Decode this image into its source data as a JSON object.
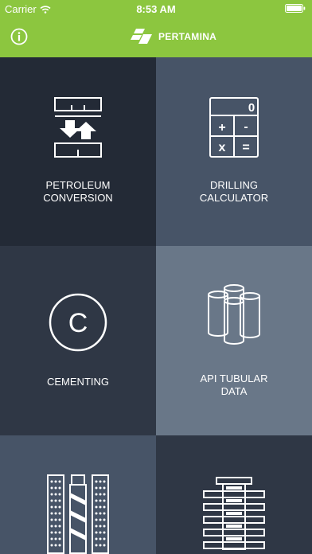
{
  "status_bar": {
    "carrier": "Carrier",
    "time": "8:53 AM"
  },
  "header": {
    "brand": "PERTAMINA",
    "info_icon": "info-circle-icon"
  },
  "tiles": [
    {
      "label_line1": "PETROLEUM",
      "label_line2": "CONVERSION",
      "icon": "conversion-arrows-icon"
    },
    {
      "label_line1": "DRILLING",
      "label_line2": "CALCULATOR",
      "icon": "calculator-icon",
      "calc_display": "0",
      "calc_keys": [
        "+",
        "-",
        "x",
        "="
      ]
    },
    {
      "label_line1": "CEMENTING",
      "icon": "copyright-c-icon",
      "icon_letter": "C"
    },
    {
      "label_line1": "API TUBULAR",
      "label_line2": "DATA",
      "icon": "pipe-tubes-icon"
    },
    {
      "icon": "drill-bit-icon"
    },
    {
      "icon": "drill-string-icon"
    }
  ],
  "colors": {
    "accent": "#8cc63f",
    "tile_dark": "#232a36",
    "tile_slate": "#475467",
    "tile_mid": "#2f3745",
    "tile_light": "#697788"
  }
}
